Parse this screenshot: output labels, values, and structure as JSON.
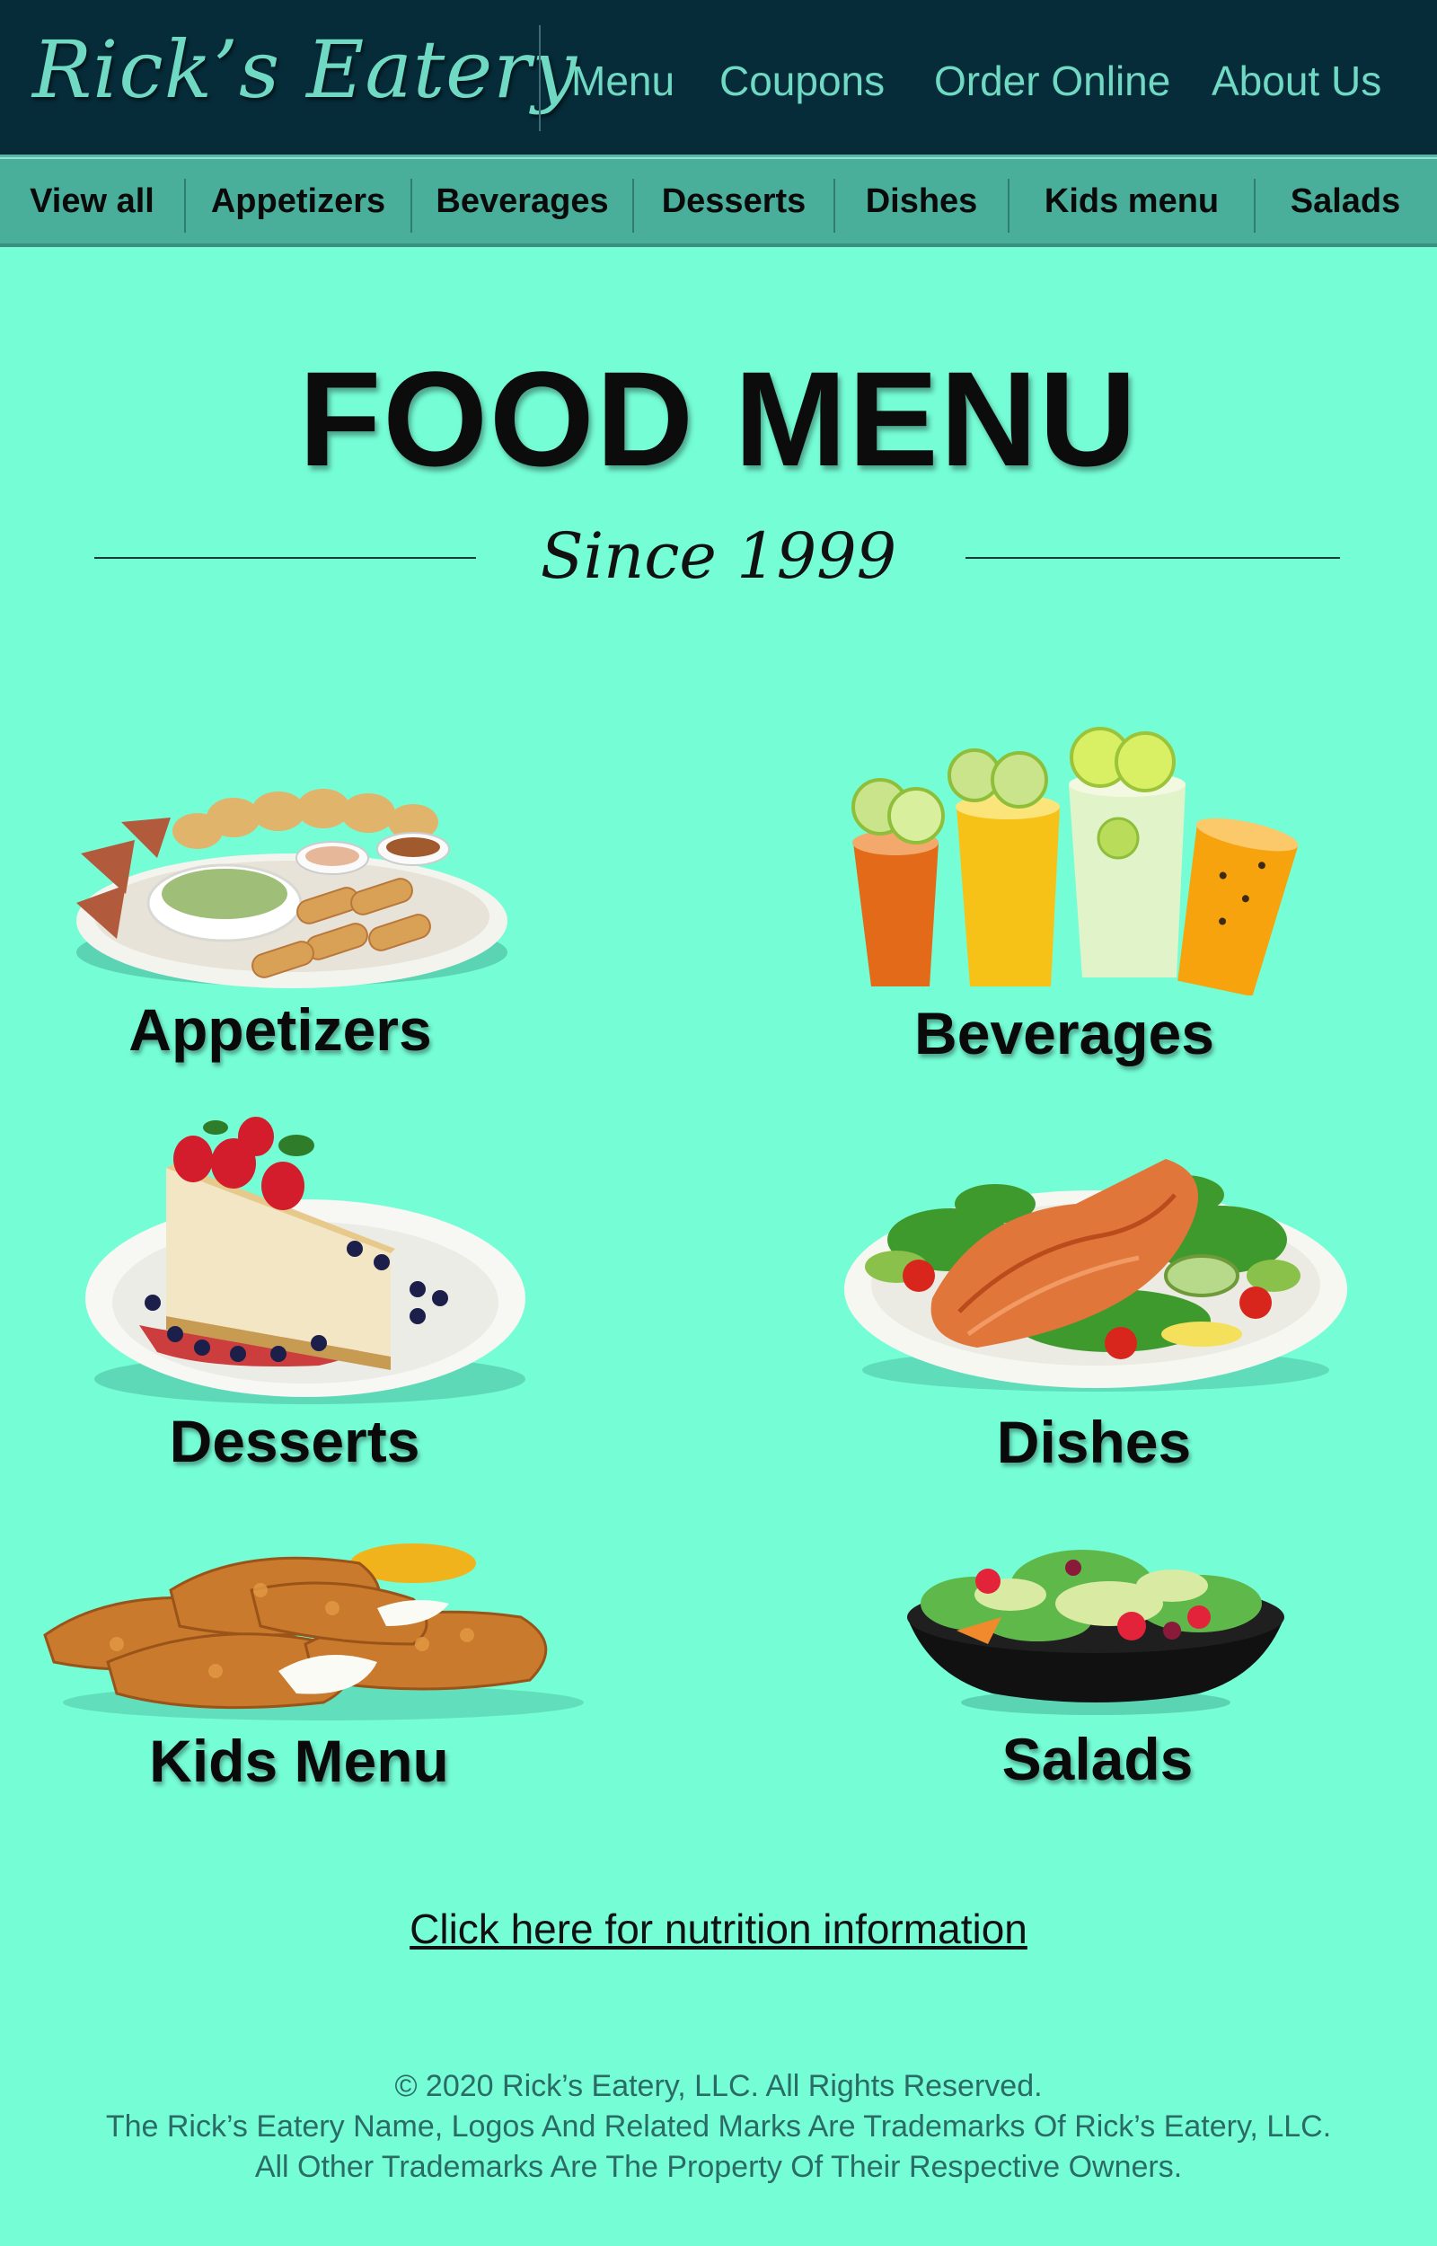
{
  "header": {
    "logo": "Rick’s Eatery",
    "nav": [
      "Menu",
      "Coupons",
      "Order Online",
      "About Us"
    ]
  },
  "categories": [
    "View all",
    "Appetizers",
    "Beverages",
    "Desserts",
    "Dishes",
    "Kids menu",
    "Salads"
  ],
  "hero": {
    "title": "FOOD MENU",
    "subtitle": "Since 1999"
  },
  "tiles": [
    {
      "label": "Appetizers",
      "image": "appetizer-platter-image"
    },
    {
      "label": "Beverages",
      "image": "iced-drinks-image"
    },
    {
      "label": "Desserts",
      "image": "cheesecake-image"
    },
    {
      "label": "Dishes",
      "image": "salmon-plate-image"
    },
    {
      "label": "Kids Menu",
      "image": "chicken-tenders-image"
    },
    {
      "label": "Salads",
      "image": "salad-bowl-image"
    }
  ],
  "nutrition_link": "Click here for nutrition information",
  "footer": {
    "line1": "© 2020 Rick’s Eatery, LLC. All Rights Reserved.",
    "line2": "The Rick’s Eatery Name, Logos And Related Marks Are Trademarks Of Rick’s Eatery, LLC.",
    "line3": "All Other Trademarks Are The Property Of Their Respective Owners."
  },
  "colors": {
    "background": "#75fdd6",
    "header": "#062c3a",
    "category_bar": "#49ae9a",
    "accent": "#6fd9c3"
  }
}
